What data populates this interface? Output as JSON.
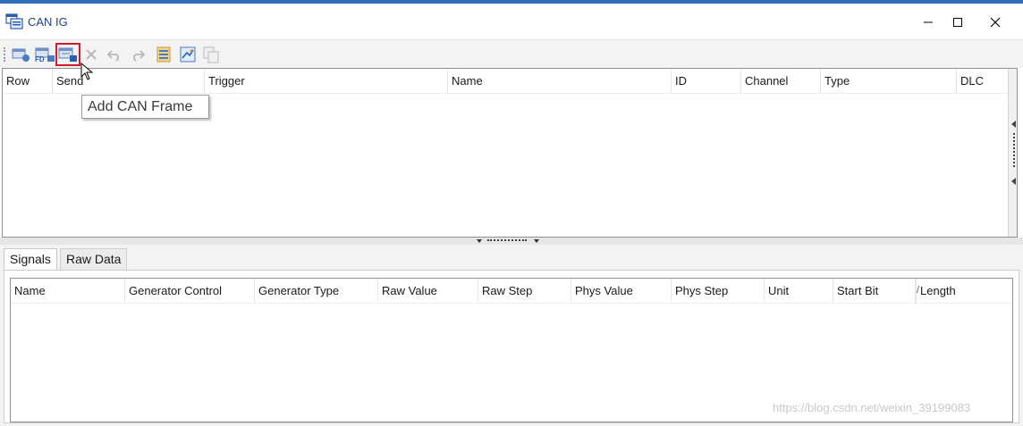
{
  "window": {
    "title": "CAN IG"
  },
  "titlebar_buttons": {
    "minimize": "—",
    "maximize": "☐",
    "close": "✕"
  },
  "toolbar": {
    "items": [
      {
        "name": "add-frame-icon",
        "enabled": true
      },
      {
        "name": "add-fd-frame-icon",
        "enabled": true,
        "label": "FD"
      },
      {
        "name": "add-can-frame-icon",
        "enabled": true,
        "highlighted": true
      },
      {
        "name": "delete-icon",
        "enabled": false
      },
      {
        "name": "undo-icon",
        "enabled": false
      },
      {
        "name": "redo-icon",
        "enabled": false
      },
      {
        "name": "import-icon",
        "enabled": true
      },
      {
        "name": "export-icon",
        "enabled": true
      },
      {
        "name": "copy-icon",
        "enabled": false
      }
    ],
    "tooltip": "Add CAN Frame"
  },
  "frames_table": {
    "columns": [
      "Row",
      "Send",
      "Trigger",
      "Name",
      "ID",
      "Channel",
      "Type",
      "DLC"
    ],
    "rows": []
  },
  "tabs": [
    {
      "label": "Signals",
      "active": true
    },
    {
      "label": "Raw Data",
      "active": false
    }
  ],
  "signals_table": {
    "columns": [
      "Name",
      "Generator Control",
      "Generator Type",
      "Raw Value",
      "Raw Step",
      "Phys Value",
      "Phys Step",
      "Unit",
      "Start Bit",
      "Length"
    ],
    "sort_indicator": "/",
    "rows": []
  },
  "watermark": "https://blog.csdn.net/weixin_39199083",
  "colors": {
    "accent": "#2f6ebd",
    "highlight": "#d11a2a",
    "title": "#1c3f8a"
  }
}
